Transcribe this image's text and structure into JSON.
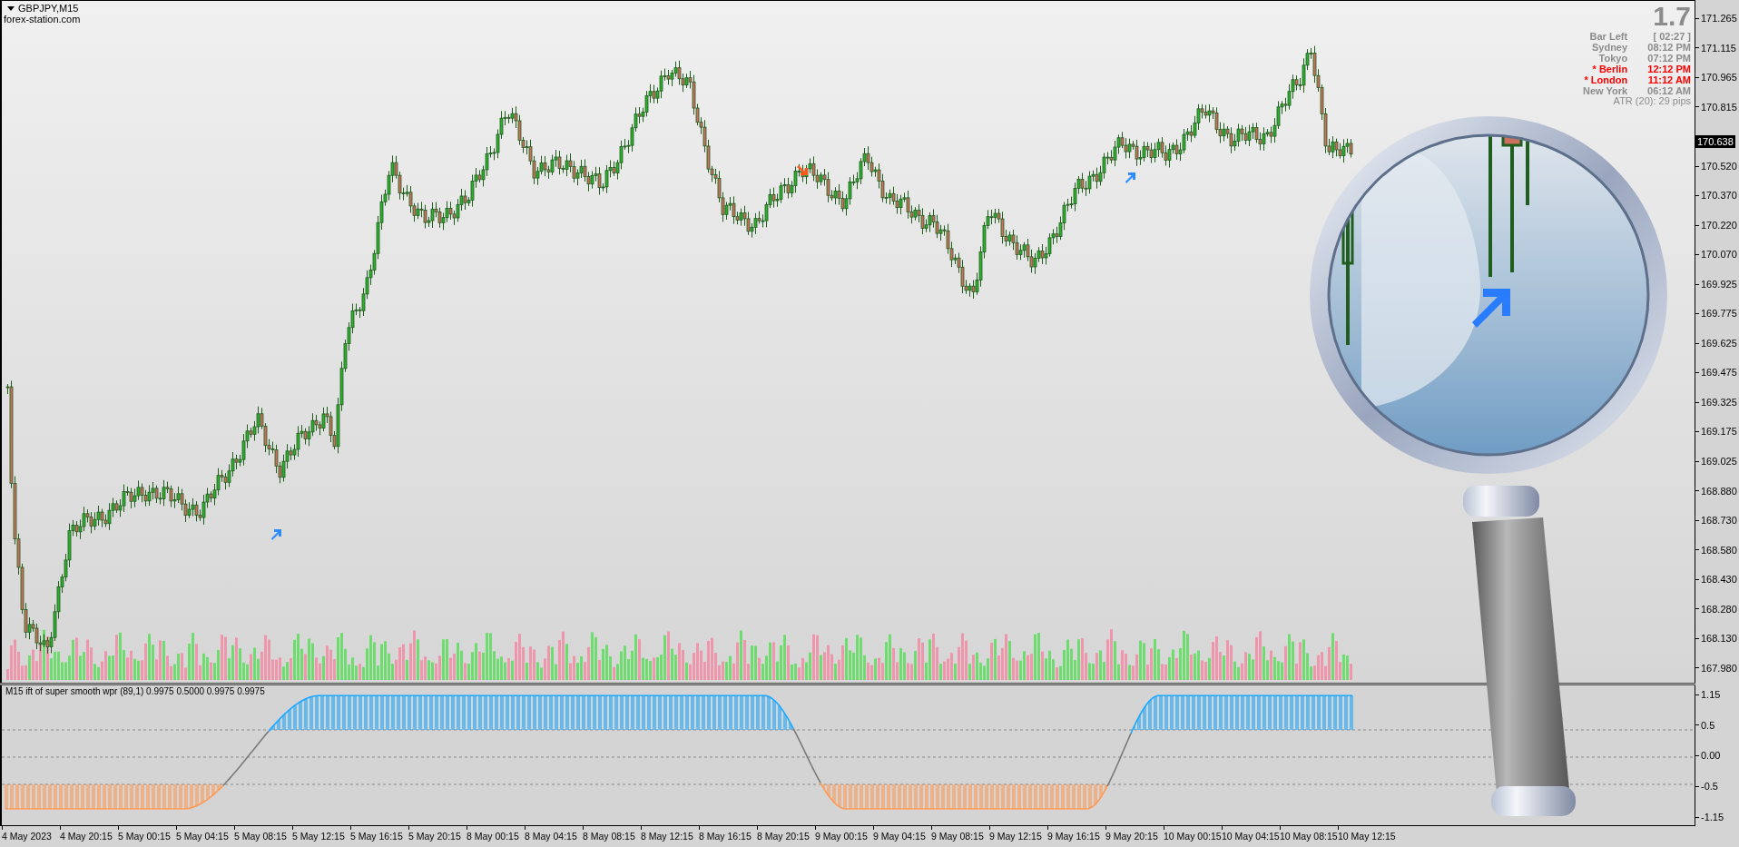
{
  "chart": {
    "symbol": "GBPJPY,M15",
    "source": "forex-station.com"
  },
  "info_panel": {
    "spread": "1.7",
    "rows": [
      {
        "label": "Bar Left",
        "value": "[ 02:27 ]",
        "color": "#8c8c8c"
      },
      {
        "label": "Sydney",
        "value": "08:12 PM",
        "color": "#8c8c8c"
      },
      {
        "label": "Tokyo",
        "value": "07:12 PM",
        "color": "#8c8c8c"
      },
      {
        "label": "* Berlin",
        "value": "12:12 PM",
        "color": "#ff0000"
      },
      {
        "label": "* London",
        "value": "11:12 AM",
        "color": "#ff0000"
      },
      {
        "label": "New York",
        "value": "06:12 AM",
        "color": "#8c8c8c"
      }
    ],
    "atr": "ATR (20): 29 pips"
  },
  "price_axis": {
    "ticks_above": [
      "171.265",
      "171.115",
      "170.965",
      "170.815"
    ],
    "current_price": "170.638",
    "ticks_below": [
      "170.520",
      "170.370",
      "170.220",
      "170.070",
      "169.925",
      "169.775",
      "169.625",
      "169.475",
      "169.325",
      "169.175",
      "169.025",
      "168.880",
      "168.730",
      "168.580",
      "168.430",
      "168.280",
      "168.130",
      "167.980"
    ]
  },
  "indicator": {
    "label": "M15 ift of super smooth wpr (89,1) 0.9975 0.5000 0.9975 0.9975",
    "axis_ticks": [
      "1.15",
      "0.5",
      "0.00",
      "-0.5",
      "-1.15"
    ]
  },
  "time_axis": {
    "labels": [
      "4 May 2023",
      "4 May 20:15",
      "5 May 00:15",
      "5 May 04:15",
      "5 May 08:15",
      "5 May 12:15",
      "5 May 16:15",
      "5 May 20:15",
      "8 May 00:15",
      "8 May 04:15",
      "8 May 08:15",
      "8 May 12:15",
      "8 May 16:15",
      "8 May 20:15",
      "9 May 00:15",
      "9 May 04:15",
      "9 May 08:15",
      "9 May 12:15",
      "9 May 16:15",
      "9 May 20:15",
      "10 May 00:15",
      "10 May 04:15",
      "10 May 08:15",
      "10 May 12:15"
    ]
  }
}
